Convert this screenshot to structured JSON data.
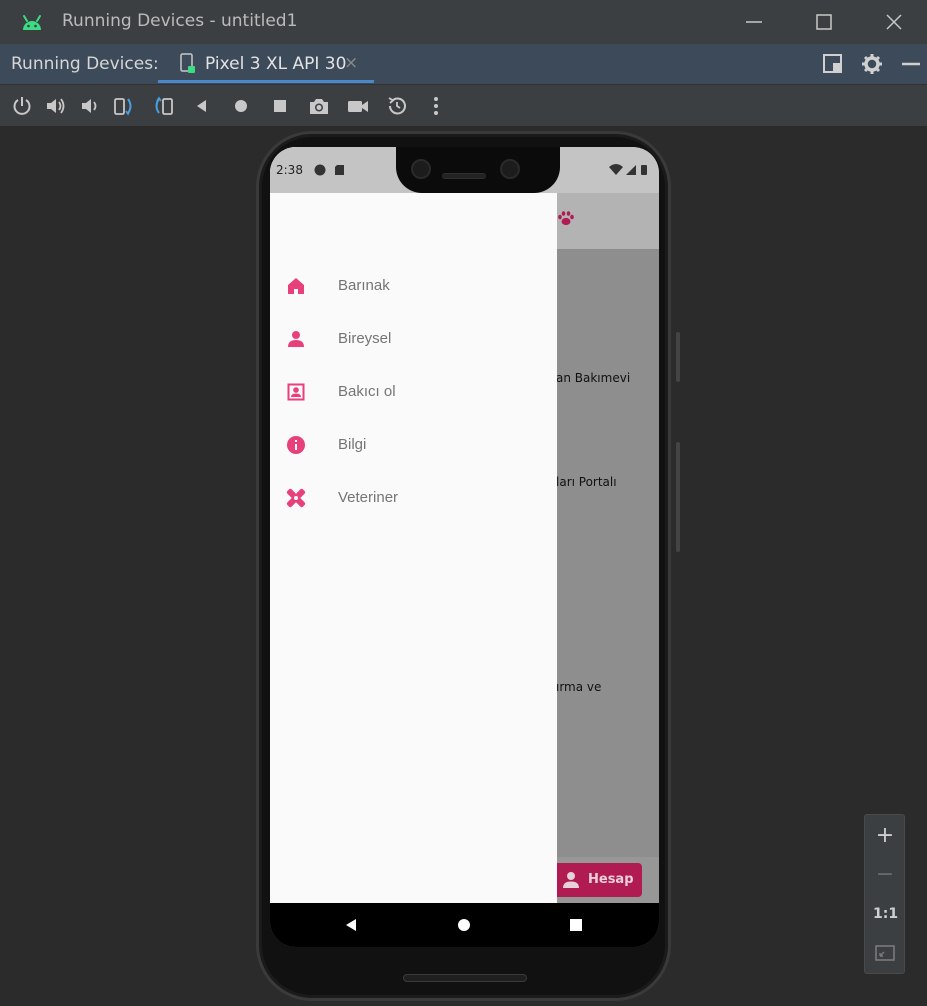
{
  "window": {
    "title": "Running Devices - untitled1",
    "app_icon": "android-icon",
    "controls": [
      "minimize-icon",
      "maximize-icon",
      "close-icon"
    ]
  },
  "tabbar": {
    "label": "Running Devices:",
    "tabs": [
      {
        "label": "Pixel 3 XL API 30",
        "icon": "device-icon",
        "close": "×"
      }
    ],
    "right_icons": [
      "layout-icon",
      "gear-icon",
      "hide-icon"
    ]
  },
  "toolbar": {
    "tools": [
      "power-icon",
      "volume-up-icon",
      "volume-down-icon",
      "rotate-left-icon",
      "rotate-right-icon",
      "back-icon",
      "home-icon",
      "overview-icon",
      "screenshot-icon",
      "screen-record-icon",
      "reset-icon",
      "more-icon"
    ]
  },
  "device": {
    "status_time": "2:38",
    "status_left_icons": [
      "sync-icon",
      "sd-card-icon"
    ],
    "status_right_icons": [
      "wifi-icon",
      "signal-icon",
      "battery-icon"
    ],
    "app_bar_icon": "paw-icon",
    "background_texts": [
      "an Bakımevi",
      "ları Portalı",
      "ırma ve"
    ],
    "account_button": {
      "label": "Hesap",
      "icon": "person-icon"
    },
    "drawer": {
      "items": [
        {
          "label": "Barınak",
          "icon": "home-icon"
        },
        {
          "label": "Bireysel",
          "icon": "person-icon"
        },
        {
          "label": "Bakıcı ol",
          "icon": "contact-icon"
        },
        {
          "label": "Bilgi",
          "icon": "info-icon"
        },
        {
          "label": "Veteriner",
          "icon": "healing-icon"
        }
      ]
    },
    "nav": [
      "back-triangle-icon",
      "home-circle-icon",
      "recents-square-icon"
    ]
  },
  "zoom": {
    "zoom_in": "+",
    "zoom_out": "−",
    "actual": "1:1",
    "fit": "fit-screen-icon"
  },
  "colors": {
    "accent": "#e8407a",
    "ide_dark": "#3c3f41",
    "tab_active": "#4a88c7",
    "android_green": "#3ddc84"
  }
}
